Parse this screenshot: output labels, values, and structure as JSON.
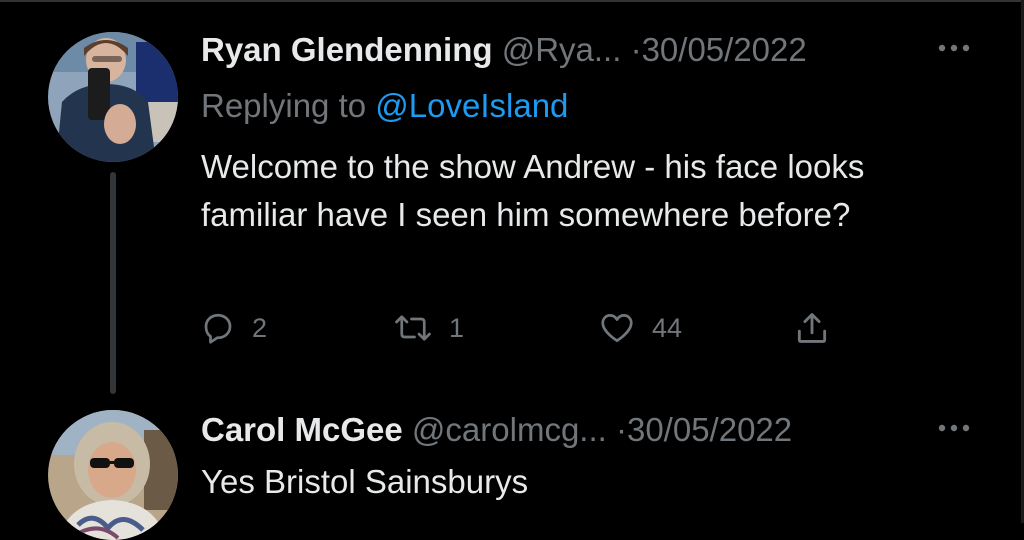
{
  "colors": {
    "background": "#000000",
    "primary_text": "#e7e9ea",
    "secondary_text": "#71767b",
    "link": "#1d9bf0",
    "thread_line": "#333639"
  },
  "tweets": [
    {
      "display_name": "Ryan Glendenning",
      "handle": "@Rya...",
      "separator": "·",
      "date": "30/05/2022",
      "replying_prefix": "Replying to",
      "replying_to": "@LoveIsland",
      "text": "Welcome to the show Andrew - his face looks familiar have I seen him somewhere before?",
      "avatar_icon": "avatar-mirror-selfie",
      "more_icon": "more-horizontal-icon",
      "actions": {
        "reply": {
          "icon": "reply-icon",
          "count": "2"
        },
        "retweet": {
          "icon": "retweet-icon",
          "count": "1"
        },
        "like": {
          "icon": "heart-icon",
          "count": "44"
        },
        "share": {
          "icon": "share-icon"
        }
      }
    },
    {
      "display_name": "Carol McGee",
      "handle": "@carolmcg...",
      "separator": "·",
      "date": "30/05/2022",
      "text": "Yes Bristol Sainsburys",
      "avatar_icon": "avatar-sunglasses-photo",
      "more_icon": "more-horizontal-icon"
    }
  ]
}
